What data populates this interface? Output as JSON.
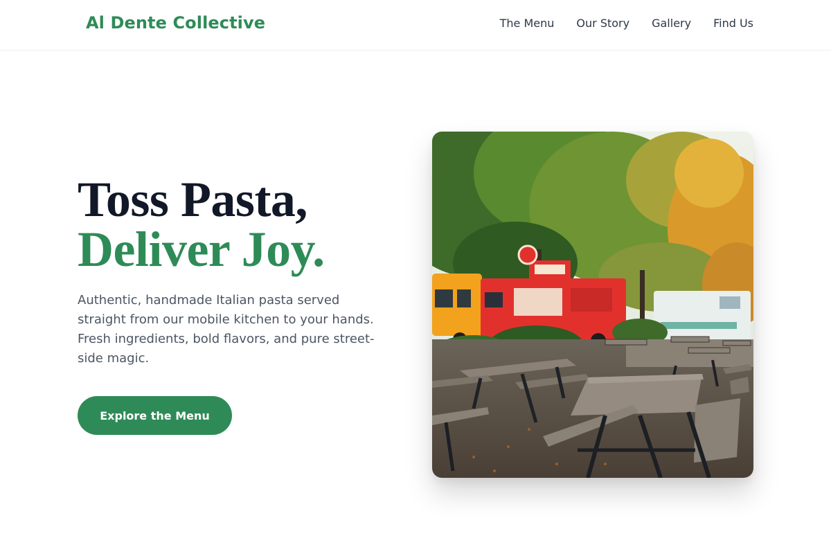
{
  "brand": {
    "name": "Al Dente Collective"
  },
  "nav": {
    "items": [
      "The Menu",
      "Our Story",
      "Gallery",
      "Find Us"
    ]
  },
  "hero": {
    "title_line1": "Toss Pasta,",
    "title_line2": "Deliver Joy.",
    "description": "Authentic, handmade Italian pasta served straight from our mobile kitchen to your hands. Fresh ingredients, bold flavors, and pure street-side magic.",
    "cta_label": "Explore the Menu"
  },
  "image": {
    "subject": "Food trucks parked among autumn trees with wooden picnic tables in the foreground"
  },
  "colors": {
    "brand_green": "#2e8b57",
    "title_dark": "#111827",
    "body_text": "#4b5563",
    "nav_text": "#2d3748"
  },
  "icons": {}
}
